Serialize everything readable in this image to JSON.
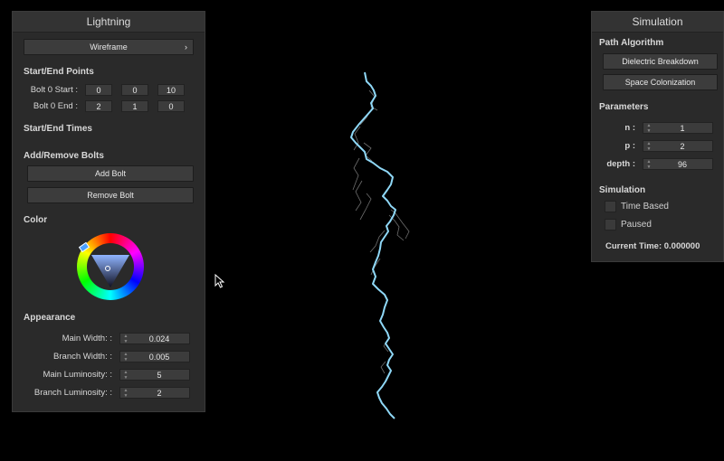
{
  "lightning_panel": {
    "title": "Lightning",
    "render_mode": "Wireframe",
    "start_end_points": {
      "heading": "Start/End Points",
      "bolt_start_label": "Bolt 0 Start :",
      "bolt_start": [
        "0",
        "0",
        "10"
      ],
      "bolt_end_label": "Bolt 0 End :",
      "bolt_end": [
        "2",
        "1",
        "0"
      ]
    },
    "start_end_times_heading": "Start/End Times",
    "add_remove": {
      "heading": "Add/Remove Bolts",
      "add_label": "Add Bolt",
      "remove_label": "Remove Bolt"
    },
    "color_heading": "Color",
    "appearance": {
      "heading": "Appearance",
      "main_width_label": "Main Width: :",
      "main_width": "0.024",
      "branch_width_label": "Branch Width: :",
      "branch_width": "0.005",
      "main_luminosity_label": "Main Luminosity: :",
      "main_luminosity": "5",
      "branch_luminosity_label": "Branch Luminosity: :",
      "branch_luminosity": "2"
    }
  },
  "simulation_panel": {
    "title": "Simulation",
    "path_algorithm_heading": "Path Algorithm",
    "dielectric_label": "Dielectric Breakdown",
    "space_colonization_label": "Space Colonization",
    "parameters_heading": "Parameters",
    "n_label": "n :",
    "n_value": "1",
    "p_label": "p :",
    "p_value": "2",
    "depth_label": "depth :",
    "depth_value": "96",
    "simulation_heading": "Simulation",
    "time_based_label": "Time Based",
    "time_based_checked": false,
    "paused_label": "Paused",
    "paused_checked": false,
    "current_time": "Current Time: 0.000000"
  },
  "viewport": {
    "bolt_color": "#8fd8f7",
    "branch_color": "#9a9a9a",
    "background": "#000000"
  }
}
